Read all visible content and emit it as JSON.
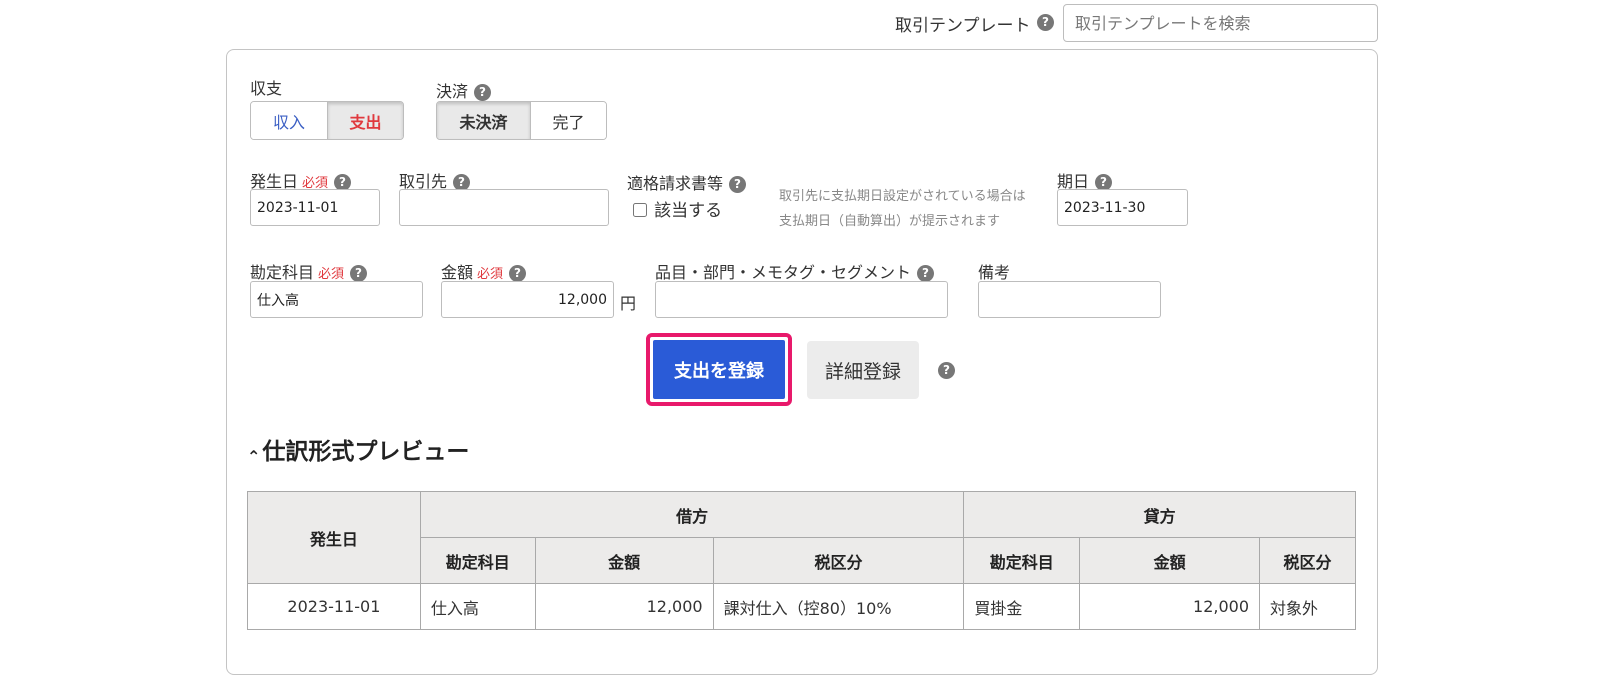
{
  "template": {
    "label": "取引テンプレート",
    "placeholder": "取引テンプレートを検索"
  },
  "form": {
    "income_expense": {
      "label": "収支",
      "options": [
        "収入",
        "支出"
      ],
      "selected": "支出"
    },
    "settlement": {
      "label": "決済",
      "options": [
        "未決済",
        "完了"
      ],
      "selected": "未決済"
    },
    "date": {
      "label": "発生日",
      "required": "必須",
      "value": "2023-11-01"
    },
    "partner": {
      "label": "取引先",
      "value": ""
    },
    "invoice": {
      "label": "適格請求書等",
      "checkbox_label": "該当する",
      "checked": false
    },
    "due_note": [
      "取引先に支払期日設定がされている場合は",
      "支払期日（自動算出）が提示されます"
    ],
    "due_date": {
      "label": "期日",
      "value": "2023-11-30"
    },
    "account": {
      "label": "勘定科目",
      "required": "必須",
      "value": "仕入高"
    },
    "amount": {
      "label": "金額",
      "required": "必須",
      "value": "12,000",
      "unit": "円"
    },
    "tags": {
      "label": "品目・部門・メモタグ・セグメント",
      "value": ""
    },
    "remarks": {
      "label": "備考",
      "value": ""
    }
  },
  "actions": {
    "register": "支出を登録",
    "detail": "詳細登録"
  },
  "preview": {
    "title": "仕訳形式プレビュー",
    "headers": {
      "date": "発生日",
      "debit": "借方",
      "credit": "貸方",
      "account": "勘定科目",
      "amount": "金額",
      "tax": "税区分"
    },
    "row": {
      "date": "2023-11-01",
      "debit_account": "仕入高",
      "debit_amount": "12,000",
      "debit_tax": "課対仕入（控80）10%",
      "credit_account": "買掛金",
      "credit_amount": "12,000",
      "credit_tax": "対象外"
    }
  },
  "colors": {
    "income_text": "#3b5fc4",
    "expense_text": "#e0393e",
    "primary_button": "#2a5bd7",
    "highlight_border": "#e8196b"
  }
}
